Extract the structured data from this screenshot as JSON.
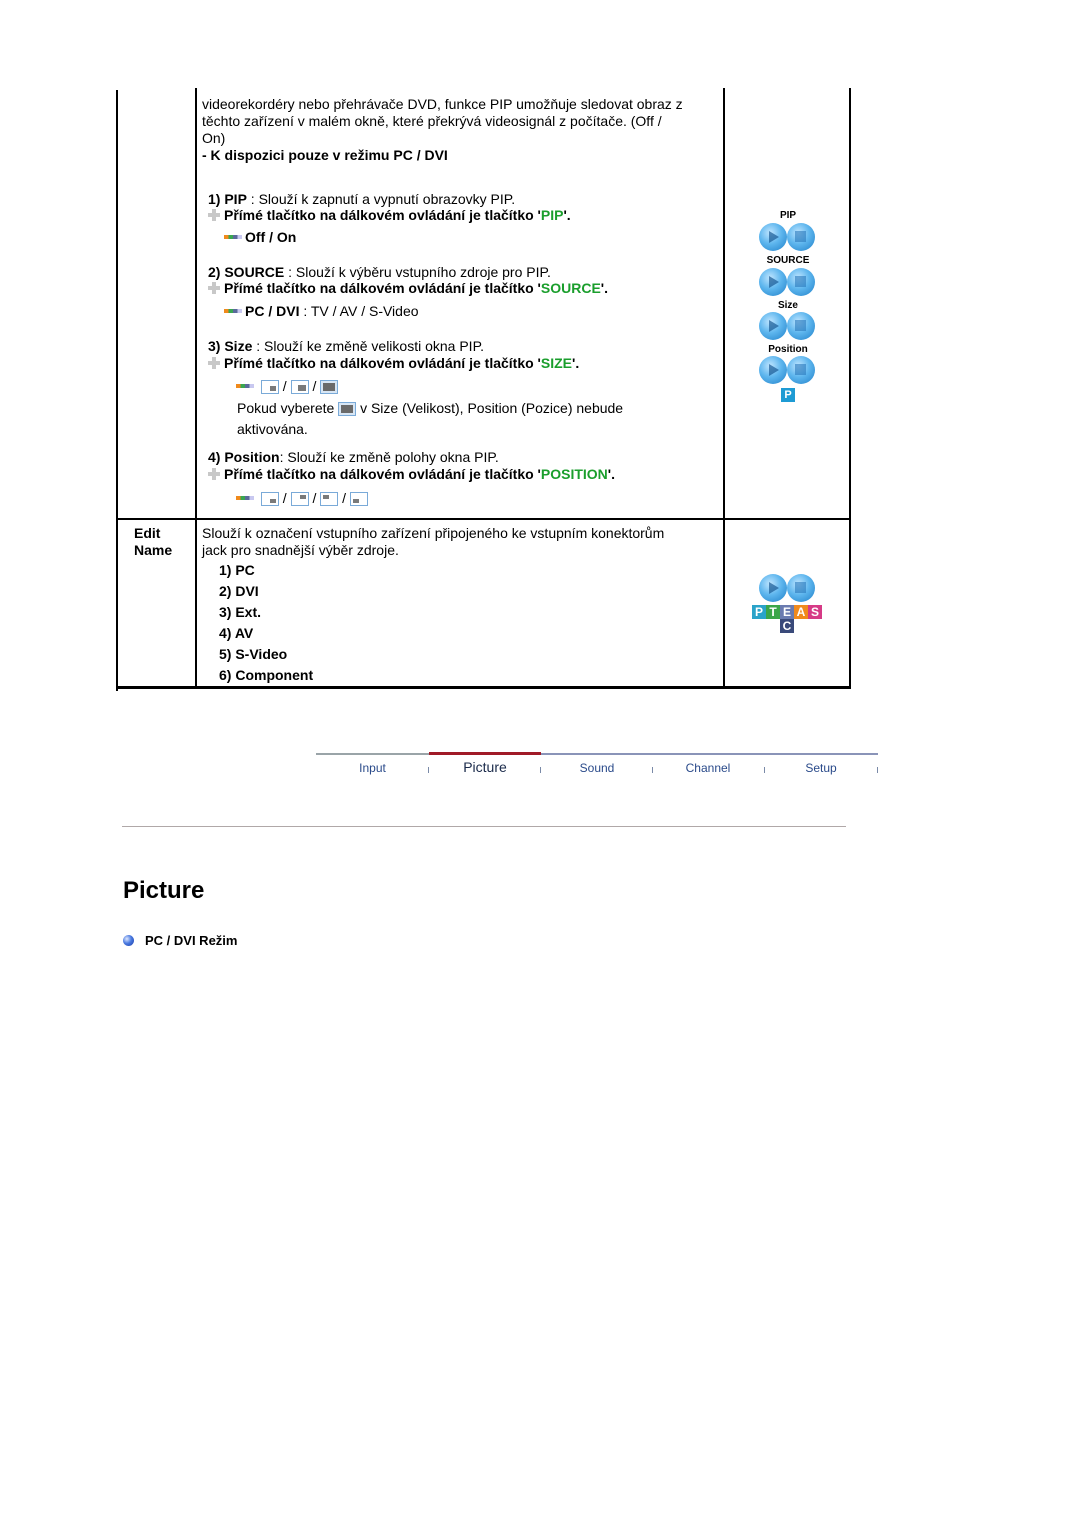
{
  "table": {
    "pip_row": {
      "intro_lines": [
        "videorekordéry nebo přehrávače DVD, funkce PIP umožňuje sledovat obraz z",
        "těchto zařízení v malém okně, které překrývá videosignál z počítače. (Off /",
        "On)"
      ],
      "availability_note": "- K dispozici pouze v režimu PC / DVI",
      "items": [
        {
          "number": "1)",
          "name": "PIP",
          "description": " : Slouží k zapnutí a vypnutí obrazovky PIP.",
          "remote_prefix": "Přímé tlačítko na dálkovém ovládání je tlačítko '",
          "remote_button": "PIP",
          "remote_suffix": "'.",
          "option_label": "Off / On",
          "option_value": ""
        },
        {
          "number": "2)",
          "name": "SOURCE",
          "description": " : Slouží k výběru vstupního zdroje pro PIP.",
          "remote_prefix": "Přímé tlačítko na dálkovém ovládání je tlačítko '",
          "remote_button": "SOURCE",
          "remote_suffix": "'.",
          "option_label": "PC / DVI",
          "option_value": " : TV / AV / S-Video"
        },
        {
          "number": "3)",
          "name": "Size",
          "description": " : Slouží ke změně velikosti okna PIP.",
          "remote_prefix": "Přímé tlačítko na dálkovém ovládání je tlačítko '",
          "remote_button": "SIZE",
          "remote_suffix": "'.",
          "options_icons": [
            "size-small-icon",
            "size-large-icon",
            "size-double-icon"
          ],
          "separator": "/",
          "note_before": "Pokud vyberete",
          "note_after": "v Size (Velikost), Position (Pozice) nebude",
          "note_line2": "aktivována."
        },
        {
          "number": "4)",
          "name": "Position",
          "description": ": Slouží ke změně polohy okna PIP.",
          "remote_prefix": "Přímé tlačítko na dálkovém ovládání je tlačítko '",
          "remote_button": "POSITION",
          "remote_suffix": "'.",
          "options_icons": [
            "position-bottom-right-icon",
            "position-top-right-icon",
            "position-top-left-icon",
            "position-bottom-left-icon"
          ],
          "separator": "/"
        }
      ],
      "remote_buttons": [
        {
          "label": "PIP",
          "icons": [
            "play-button-icon",
            "stop-button-icon"
          ]
        },
        {
          "label": "SOURCE",
          "icons": [
            "play-button-icon",
            "stop-button-icon"
          ]
        },
        {
          "label": "Size",
          "icons": [
            "play-button-icon",
            "stop-button-icon"
          ]
        },
        {
          "label": "Position",
          "icons": [
            "play-button-icon",
            "stop-button-icon"
          ]
        }
      ],
      "p_badge": "P"
    },
    "edit_name_row": {
      "label_line1": "Edit",
      "label_line2": "Name",
      "description_line1": "Slouží k označení vstupního zařízení připojeného ke vstupním konektorům",
      "description_line2": "jack pro snadnější výběr zdroje.",
      "options": [
        "1) PC",
        "2) DVI",
        "3) Ext.",
        "4) AV",
        "5) S-Video",
        "6) Component"
      ],
      "tiles": [
        {
          "letter": "P",
          "color": "#2aa3c9"
        },
        {
          "letter": "T",
          "color": "#3aa648"
        },
        {
          "letter": "E",
          "color": "#6a7bb0"
        },
        {
          "letter": "A",
          "color": "#f08a1c"
        },
        {
          "letter": "S",
          "color": "#d63a86"
        },
        {
          "letter": "C",
          "color": "#3a4a7a"
        }
      ]
    }
  },
  "nav": {
    "items": [
      "Input",
      "Picture",
      "Sound",
      "Channel",
      "Setup"
    ],
    "active": "Picture",
    "active_color": "#a01a28"
  },
  "section": {
    "title": "Picture",
    "subsection": "PC / DVI Režim"
  }
}
